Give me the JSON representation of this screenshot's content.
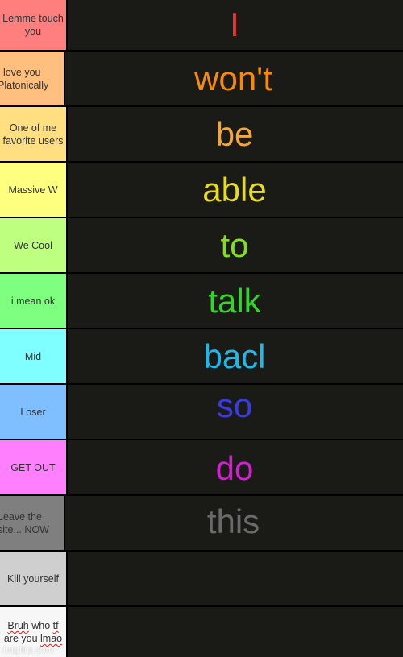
{
  "tiers": [
    {
      "label": "Lemme touch you",
      "label_lines": [
        "Lemme touch",
        "you"
      ],
      "color": "#ff7f7f",
      "word": "I",
      "word_color": "#e33535"
    },
    {
      "label": "I love you Platonically",
      "label_lines": [
        "I love you",
        "Platonically"
      ],
      "color": "#ffbf7f",
      "word": "won't",
      "word_color": "#f58a0f"
    },
    {
      "label": "One of me favorite users",
      "label_lines": [
        "One of me",
        "favorite users"
      ],
      "color": "#ffdf7f",
      "word": "be",
      "word_color": "#f5a83a"
    },
    {
      "label": "Massive W",
      "label_lines": [
        "Massive W"
      ],
      "color": "#ffff7f",
      "word": "able",
      "word_color": "#e8dd1a"
    },
    {
      "label": "We Cool",
      "label_lines": [
        "We Cool"
      ],
      "color": "#bfff7f",
      "word": "to",
      "word_color": "#7fe01c"
    },
    {
      "label": "i mean ok",
      "label_lines": [
        "i mean ok"
      ],
      "color": "#7fff7f",
      "word": "talk",
      "word_color": "#36d42a"
    },
    {
      "label": "Mid",
      "label_lines": [
        "Mid"
      ],
      "color": "#7fffff",
      "word": "bacl",
      "word_color": "#1fb8e8"
    },
    {
      "label": "Loser",
      "label_lines": [
        "Loser"
      ],
      "color": "#7fbfff",
      "word": "so",
      "word_color": "#3a3ae6"
    },
    {
      "label": "GET OUT",
      "label_lines": [
        "GET OUT"
      ],
      "color": "#ff7fff",
      "word": "do",
      "word_color": "#d21fcf"
    },
    {
      "label": "Leave the site... NOW",
      "label_lines": [
        "Leave the",
        "site... NOW"
      ],
      "color": "#7f7f7f",
      "word": "this",
      "word_color": "#6a6a6a"
    },
    {
      "label": "Kill yourself",
      "label_lines": [
        "Kill yourself"
      ],
      "color": "#cfcfcf",
      "word": "",
      "word_color": "#ffffff"
    },
    {
      "label": "Bruh who tf are you lmao",
      "label_lines": [
        "Bruh who tf",
        "are you lmao"
      ],
      "color": "#f7f7f7",
      "word": "",
      "word_color": "#ffffff"
    }
  ],
  "watermark": "imgflip.com"
}
